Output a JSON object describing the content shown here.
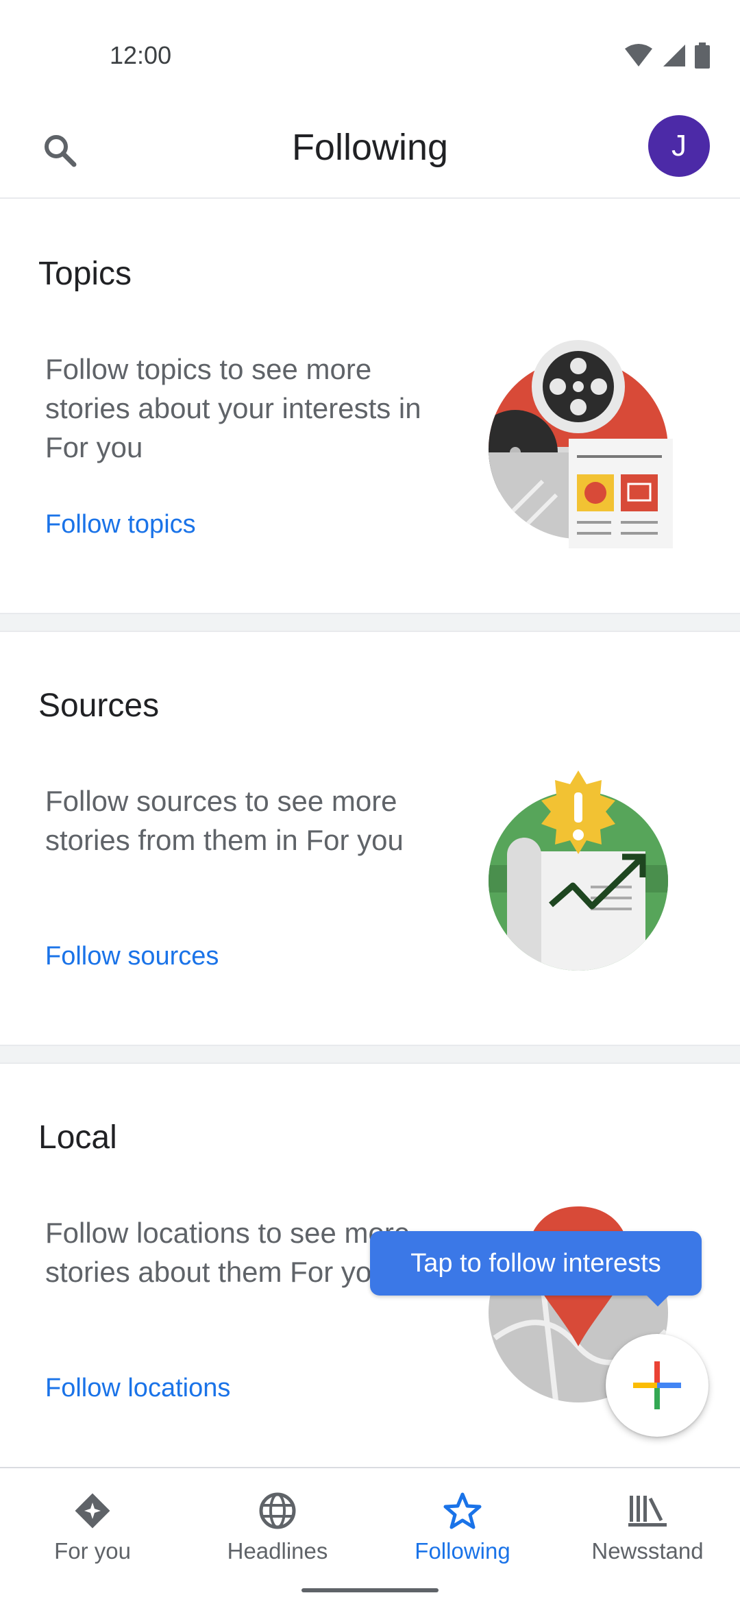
{
  "status_bar": {
    "time": "12:00"
  },
  "app_bar": {
    "title": "Following",
    "avatar_initial": "J"
  },
  "sections": [
    {
      "title": "Topics",
      "description": "Follow topics to see more stories about your interests in For you",
      "link": "Follow topics",
      "illustration": "film-news-illustration"
    },
    {
      "title": "Sources",
      "description": "Follow sources to see more stories from them in For you",
      "link": "Follow sources",
      "illustration": "newspaper-trend-illustration"
    },
    {
      "title": "Local",
      "description": "Follow locations to see more stories about them For you",
      "link": "Follow locations",
      "illustration": "map-pin-illustration"
    }
  ],
  "tooltip": {
    "text": "Tap to follow interests"
  },
  "bottom_nav": {
    "items": [
      {
        "label": "For you",
        "icon": "diamond-sparkle-icon"
      },
      {
        "label": "Headlines",
        "icon": "globe-icon"
      },
      {
        "label": "Following",
        "icon": "star-outline-icon",
        "active": true
      },
      {
        "label": "Newsstand",
        "icon": "newsstand-icon"
      }
    ]
  },
  "colors": {
    "accent": "#1a73e8",
    "avatar": "#4c2aa7",
    "tooltip": "#3b78e7"
  }
}
